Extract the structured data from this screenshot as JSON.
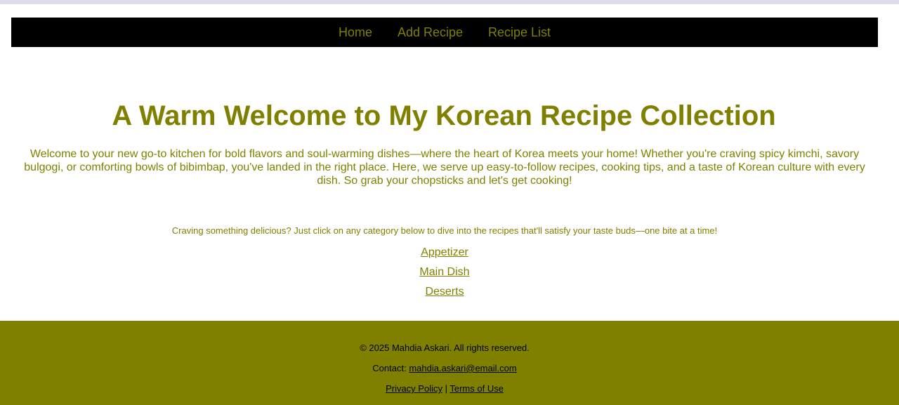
{
  "nav": {
    "items": [
      "Home",
      "Add Recipe",
      "Recipe List"
    ]
  },
  "hero": {
    "title": "A Warm Welcome to My Korean Recipe Collection",
    "text": "Welcome to your new go-to kitchen for bold flavors and soul-warming dishes—where the heart of Korea meets your home! Whether you're craving spicy kimchi, savory bulgogi, or comforting bowls of bibimbap, you've landed in the right place. Here, we serve up easy-to-follow recipes, cooking tips, and a taste of Korean culture with every dish. So grab your chopsticks and let's get cooking!"
  },
  "categories": {
    "intro": "Craving something delicious? Just click on any category below to dive into the recipes that'll satisfy your taste buds—one bite at a time!",
    "links": [
      "Appetizer",
      "Main Dish",
      "Deserts"
    ]
  },
  "footer": {
    "copyright": "© 2025 Mahdia Askari. All rights reserved.",
    "contact_label": "Contact: ",
    "contact_email": "mahdia.askari@email.com",
    "privacy": "Privacy Policy",
    "separator": " | ",
    "terms": "Terms of Use"
  },
  "colors": {
    "accent": "#808000",
    "navbar_bg": "#000000",
    "background": "#ffffff"
  }
}
